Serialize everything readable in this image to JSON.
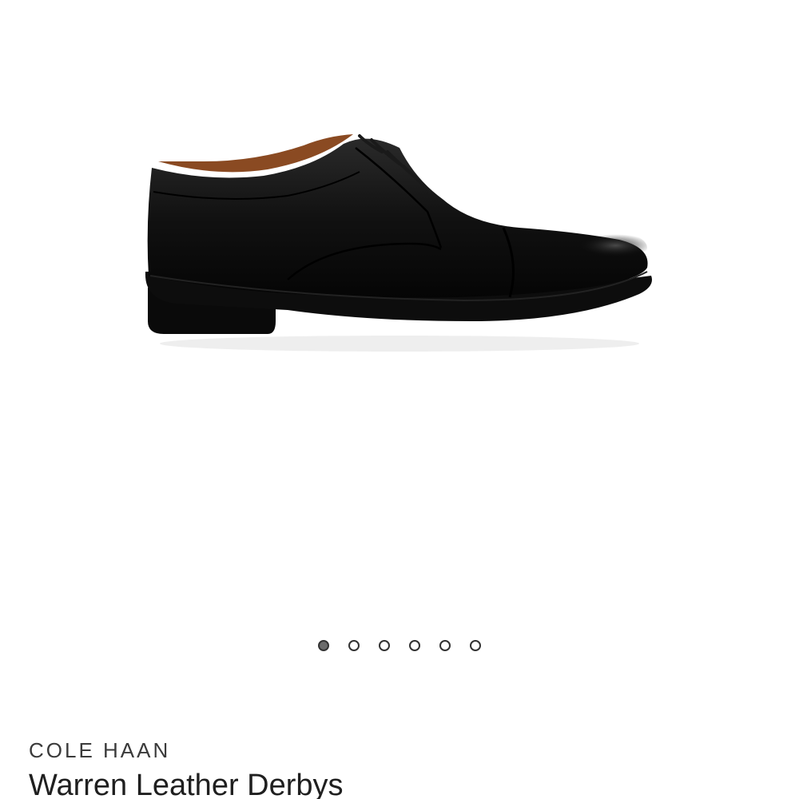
{
  "product": {
    "brand": "COLE HAAN",
    "name": "Warren Leather Derbys",
    "image_alt": "black leather cap-toe derby shoe"
  },
  "carousel": {
    "total": 6,
    "active_index": 0
  },
  "colors": {
    "active_dot": "#6b6b6b",
    "dot_border": "#333333",
    "shoe_leather": "#111111",
    "shoe_lining": "#8a4a22"
  }
}
